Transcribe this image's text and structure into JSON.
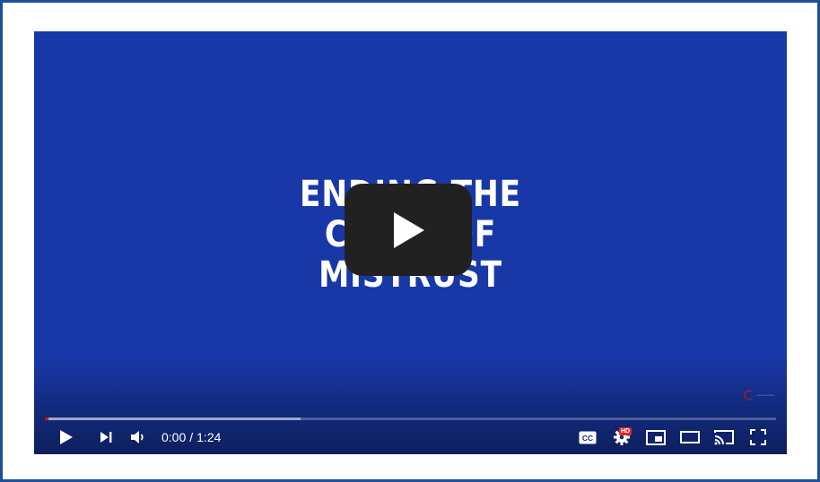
{
  "video": {
    "title_lines": [
      "ENDING THE",
      "CYCLE OF",
      "MISTRUST"
    ],
    "background_color": "#1838a7"
  },
  "watermark": {
    "label": "channel-watermark"
  },
  "progress": {
    "played_fraction": 0.0,
    "loaded_fraction": 0.35
  },
  "controls": {
    "current_time": "0:00",
    "separator": "/",
    "duration": "1:24",
    "hd_badge": "HD"
  },
  "icons": {
    "big_play": "play-icon",
    "play": "play-icon",
    "next": "next-icon",
    "volume": "volume-icon",
    "captions": "captions-icon",
    "settings": "gear-icon",
    "miniplayer": "miniplayer-icon",
    "theater": "theater-icon",
    "cast": "cast-icon",
    "fullscreen": "fullscreen-icon"
  },
  "colors": {
    "accent": "#ff0000",
    "frame": "#1f4f98"
  }
}
